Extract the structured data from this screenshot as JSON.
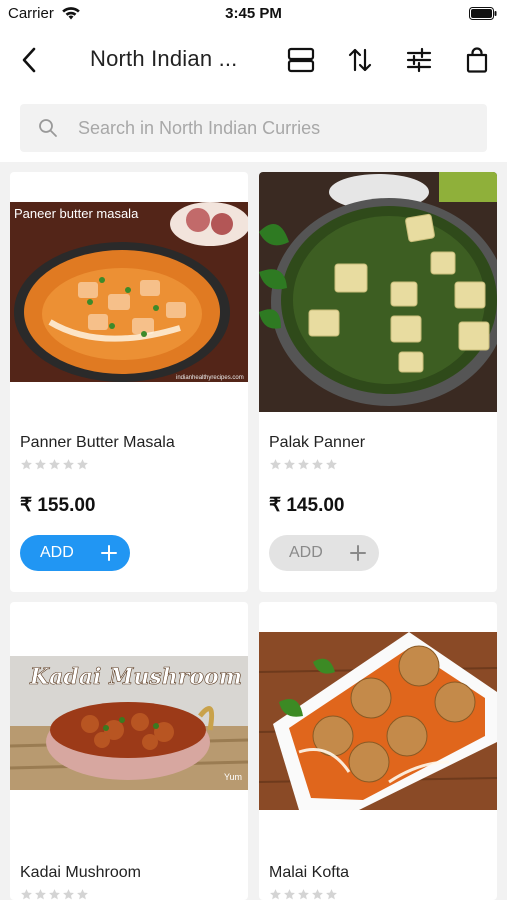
{
  "status_bar": {
    "carrier": "Carrier",
    "time": "3:45 PM"
  },
  "nav": {
    "title": "North Indian ...",
    "icons": [
      "back-icon",
      "view-toggle-icon",
      "sort-icon",
      "filter-icon",
      "bag-icon"
    ]
  },
  "search": {
    "placeholder": "Search in North Indian Curries"
  },
  "products": [
    {
      "name": "Panner Butter Masala",
      "price": "₹ 155.00",
      "rating": 0,
      "add_label": "ADD",
      "add_enabled": true,
      "image_caption": "Paneer butter masala",
      "image_watermark": "indianhealthyrecipes.com"
    },
    {
      "name": "Palak Panner",
      "price": "₹ 145.00",
      "rating": 0,
      "add_label": "ADD",
      "add_enabled": false
    },
    {
      "name": "Kadai Mushroom",
      "rating": 0,
      "image_caption": "Kadai Mushroom",
      "image_watermark": "Yum"
    },
    {
      "name": "Malai Kofta",
      "rating": 0
    }
  ],
  "colors": {
    "accent": "#2196f3",
    "disabled": "#e3e3e3",
    "star": "#d4d4d4"
  }
}
